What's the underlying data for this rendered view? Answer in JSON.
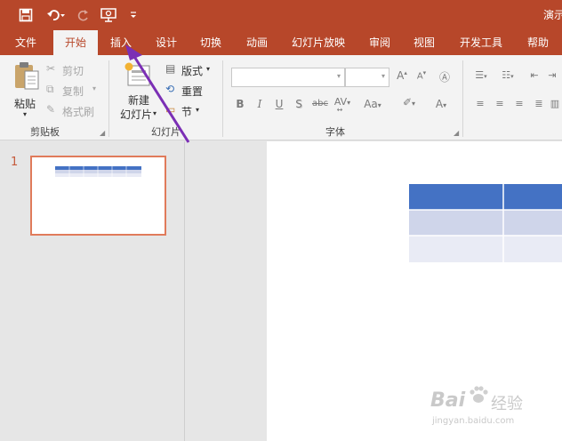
{
  "titlebar": {
    "save_icon": "save-icon",
    "undo_icon": "undo-icon",
    "redo_icon": "redo-icon",
    "present_icon": "present-from-start-icon",
    "customize_icon": "customize-qat-icon",
    "doc_title": "演示"
  },
  "tabs": [
    {
      "label": "文件"
    },
    {
      "label": "开始",
      "active": true
    },
    {
      "label": "插入"
    },
    {
      "label": "设计"
    },
    {
      "label": "切换"
    },
    {
      "label": "动画"
    },
    {
      "label": "幻灯片放映"
    },
    {
      "label": "审阅"
    },
    {
      "label": "视图"
    },
    {
      "label": "开发工具"
    },
    {
      "label": "帮助"
    }
  ],
  "ribbon": {
    "clipboard": {
      "paste_label": "粘贴",
      "cut_label": "剪切",
      "copy_label": "复制",
      "format_painter_label": "格式刷",
      "group_label": "剪贴板"
    },
    "slides": {
      "new_slide_label_1": "新建",
      "new_slide_label_2": "幻灯片",
      "layout_label": "版式",
      "reset_label": "重置",
      "section_label": "节",
      "group_label": "幻灯片"
    },
    "font": {
      "font_name_value": "",
      "font_size_value": "",
      "bold": "B",
      "italic": "I",
      "underline": "U",
      "shadow": "S",
      "strikethrough": "abc",
      "spacing": "AV",
      "change_case": "Aa",
      "font_color": "A",
      "group_label": "字体"
    }
  },
  "pane": {
    "slide_number": "1"
  },
  "slide_table": {
    "header_color": "#4472c4",
    "row1_color": "#cfd5ea",
    "row2_color": "#e9ebf5"
  },
  "watermark": {
    "brand": "Bai",
    "product": "经验",
    "url": "jingyan.baidu.com"
  },
  "colors": {
    "accent": "#b7472a",
    "annotation_arrow": "#7b2fb5",
    "thumb_border": "#e07b5b"
  }
}
